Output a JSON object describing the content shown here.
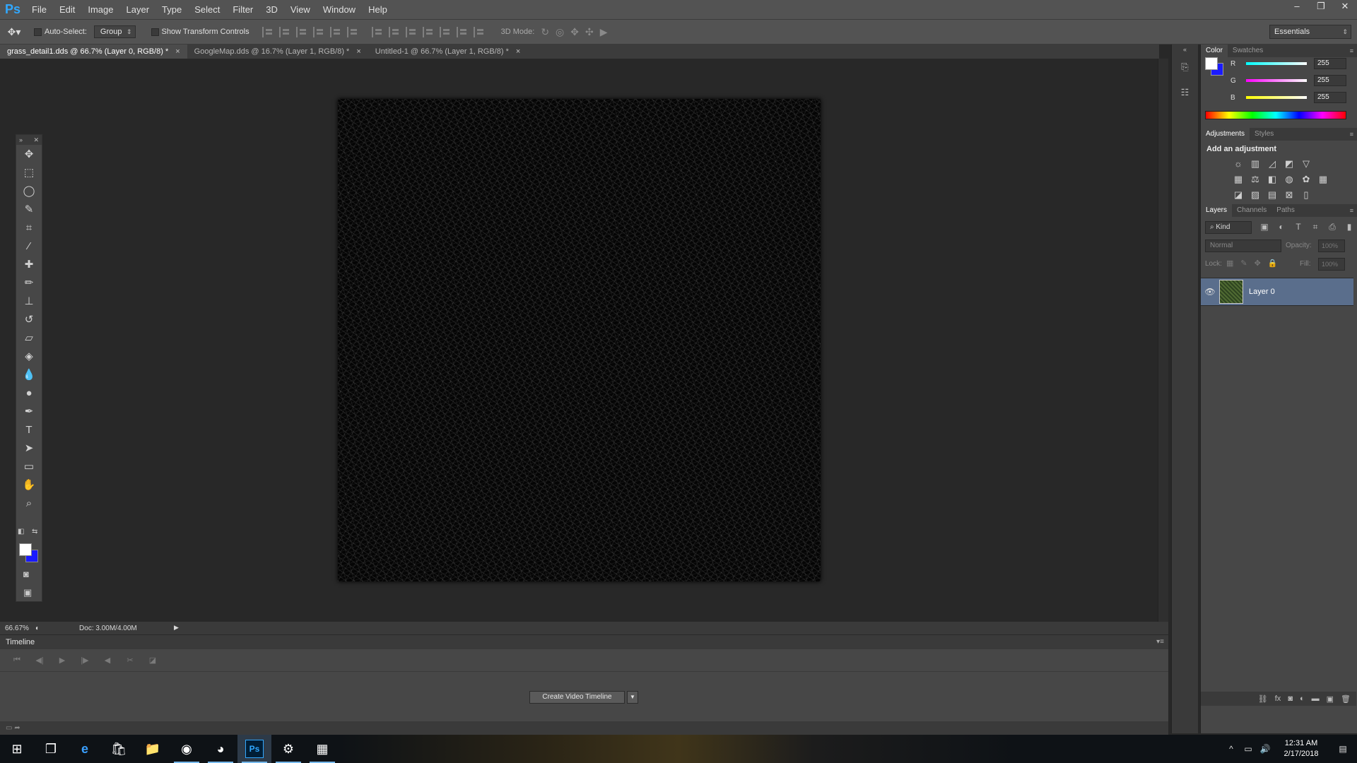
{
  "app": {
    "logo": "Ps"
  },
  "menu": [
    "File",
    "Edit",
    "Image",
    "Layer",
    "Type",
    "Select",
    "Filter",
    "3D",
    "View",
    "Window",
    "Help"
  ],
  "window_controls": {
    "minimize": "–",
    "restore": "❐",
    "close": "✕"
  },
  "options": {
    "auto_select_label": "Auto-Select:",
    "auto_select_value": "Group",
    "show_transform_label": "Show Transform Controls",
    "mode3d_label": "3D Mode:",
    "workspace": "Essentials"
  },
  "tabs": [
    {
      "title": "grass_detail1.dds @ 66.7% (Layer 0, RGB/8) *",
      "active": true
    },
    {
      "title": "GoogleMap.dds @ 16.7% (Layer 1, RGB/8) *",
      "active": false
    },
    {
      "title": "Untitled-1 @ 66.7% (Layer 1, RGB/8) *",
      "active": false
    }
  ],
  "tab_close": "×",
  "status": {
    "zoom": "66.67%",
    "doc_size": "Doc: 3.00M/4.00M"
  },
  "timeline": {
    "title": "Timeline",
    "create_button": "Create Video Timeline"
  },
  "color_panel": {
    "tabs": [
      "Color",
      "Swatches"
    ],
    "fg_color": "#ffffff",
    "bg_color": "#1a1aff",
    "r_label": "R",
    "r_value": "255",
    "g_label": "G",
    "g_value": "255",
    "b_label": "B",
    "b_value": "255"
  },
  "adjustments_panel": {
    "tabs": [
      "Adjustments",
      "Styles"
    ],
    "title": "Add an adjustment"
  },
  "layers_panel": {
    "tabs": [
      "Layers",
      "Channels",
      "Paths"
    ],
    "filter": "Kind",
    "blend_mode": "Normal",
    "opacity_label": "Opacity:",
    "opacity_value": "100%",
    "lock_label": "Lock:",
    "fill_label": "Fill:",
    "fill_value": "100%",
    "layer_name": "Layer 0"
  },
  "taskbar": {
    "time": "12:31 AM",
    "date": "2/17/2018",
    "ps_label": "Ps"
  }
}
